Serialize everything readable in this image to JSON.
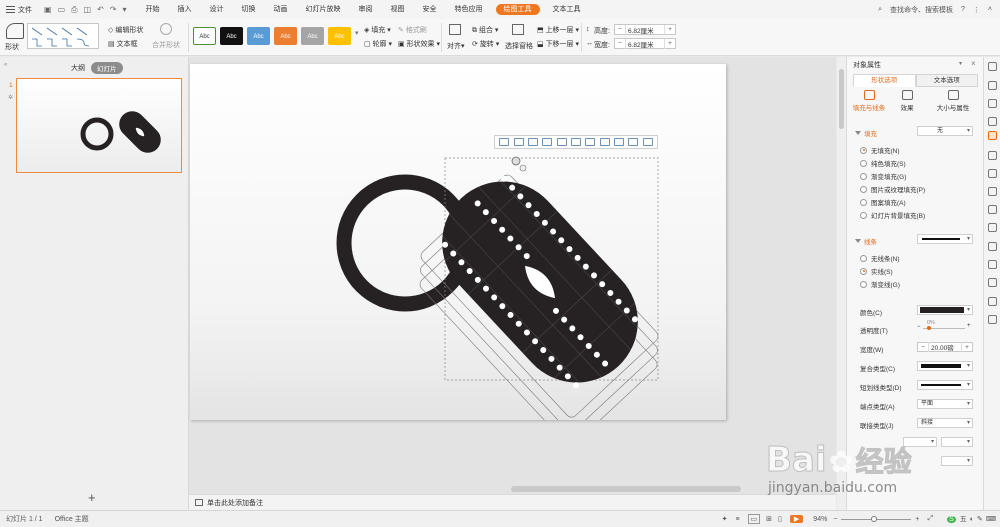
{
  "menubar": {
    "file_label": "文件",
    "tabs": [
      "开始",
      "插入",
      "设计",
      "切换",
      "动画",
      "幻灯片放映",
      "审阅",
      "视图",
      "安全",
      "特色应用",
      "绘图工具",
      "文本工具"
    ],
    "active_tab": "绘图工具",
    "search_label": "查找命令、搜索模板"
  },
  "ribbon": {
    "shape_label": "形状",
    "edit_shape": "编辑形状",
    "textbox": "文本框",
    "merge_shape": "合并形状",
    "styles": [
      {
        "label": "Abc",
        "bg": "#ffffff",
        "fg": "#333333",
        "border": "#4f8f3a"
      },
      {
        "label": "Abc",
        "bg": "#111111",
        "fg": "#ffffff",
        "border": "#111111"
      },
      {
        "label": "Abc",
        "bg": "#5b9bd5",
        "fg": "#ffffff",
        "border": "#5b9bd5"
      },
      {
        "label": "Abc",
        "bg": "#ed7d31",
        "fg": "#ffffff",
        "border": "#ed7d31"
      },
      {
        "label": "Abc",
        "bg": "#a5a5a5",
        "fg": "#ffffff",
        "border": "#a5a5a5"
      },
      {
        "label": "Abc",
        "bg": "#ffc000",
        "fg": "#ffffff",
        "border": "#ffc000"
      }
    ],
    "fill": "填充",
    "outline": "轮廓",
    "format_painter": "格式刷",
    "shape_effect": "形状效果",
    "align": "对齐",
    "group": "组合",
    "rotate": "旋转",
    "select_pane": "选择窗格",
    "bring_forward": "上移一层",
    "send_backward": "下移一层",
    "height_label": "高度:",
    "height_value": "6.82厘米",
    "width_label": "宽度:",
    "width_value": "6.82厘米"
  },
  "leftpanel": {
    "tab_outline": "大纲",
    "tab_slides": "幻灯片",
    "slide_number": "1"
  },
  "notes_placeholder": "单击此处添加备注",
  "rightpanel": {
    "title": "对象属性",
    "tab_shape": "形状选项",
    "tab_text": "文本选项",
    "sub_fill": "填充与线条",
    "sub_effect": "效果",
    "sub_size": "大小与属性",
    "fill_section": "填充",
    "fill_value": "无",
    "fill_options": [
      "无填充(N)",
      "纯色填充(S)",
      "渐变填充(G)",
      "图片或纹理填充(P)",
      "图案填充(A)",
      "幻灯片背景填充(B)"
    ],
    "line_section": "线条",
    "line_options": [
      "无线条(N)",
      "实线(S)",
      "渐变线(G)"
    ],
    "color_label": "颜色(C)",
    "transparency_label": "透明度(T)",
    "transparency_value": "0%",
    "width_label": "宽度(W)",
    "width_value": "20.00磅",
    "compound_label": "复合类型(C)",
    "dash_label": "短划线类型(D)",
    "cap_label": "端点类型(A)",
    "cap_value": "平面",
    "join_label": "联接类型(J)",
    "join_value": "斜接"
  },
  "status": {
    "slide_info": "幻灯片 1 / 1",
    "theme": "Office 主题",
    "zoom": "94%"
  },
  "watermark": {
    "brand": "Bai",
    "brand2": "经验",
    "url": "jingyan.baidu.com"
  },
  "colors": {
    "accent": "#f0771f",
    "shape": "#262223"
  }
}
